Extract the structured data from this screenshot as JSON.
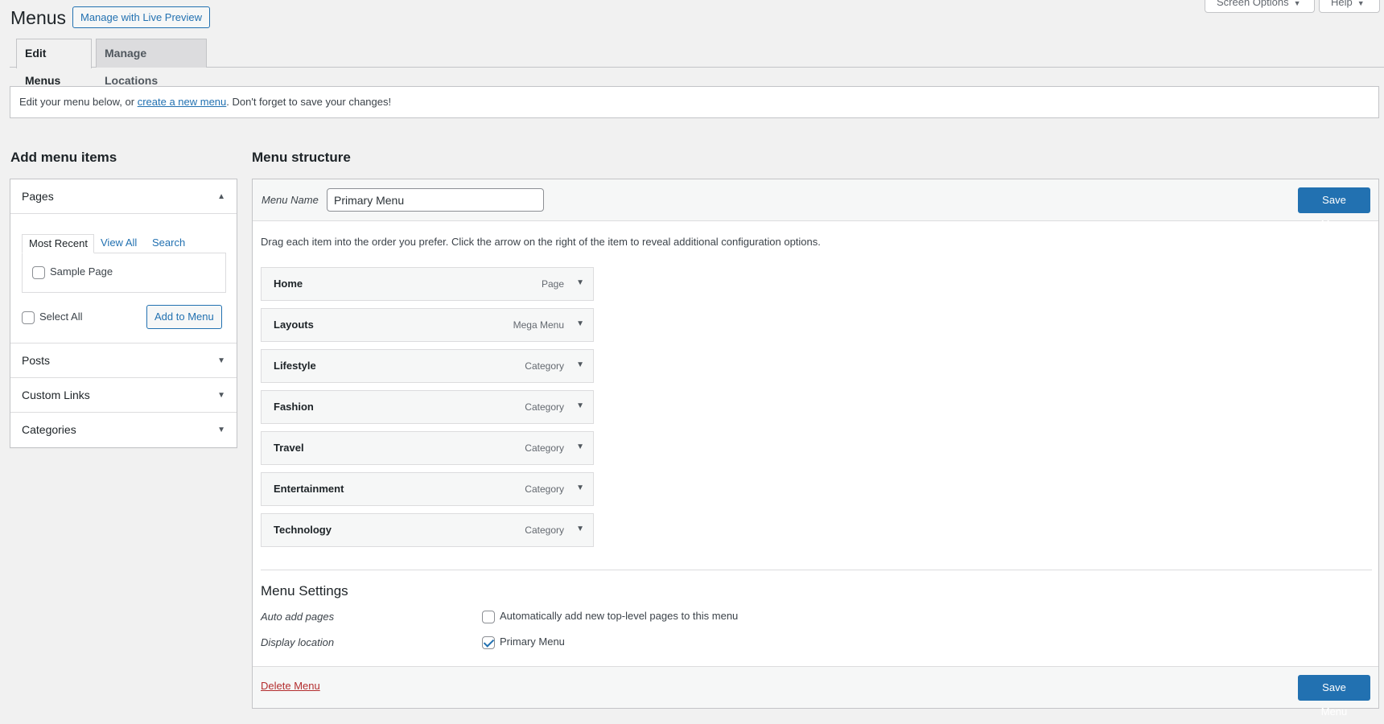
{
  "header": {
    "title": "Menus",
    "live_preview_label": "Manage with Live Preview",
    "screen_options_label": "Screen Options",
    "help_label": "Help"
  },
  "tabs": [
    {
      "label": "Edit Menus",
      "active": true
    },
    {
      "label": "Manage Locations",
      "active": false
    }
  ],
  "notice": {
    "before": "Edit your menu below, or ",
    "link": "create a new menu",
    "after": ". Don't forget to save your changes!"
  },
  "left": {
    "heading": "Add menu items",
    "pages": {
      "title": "Pages",
      "tabs": [
        "Most Recent",
        "View All",
        "Search"
      ],
      "items": [
        {
          "label": "Sample Page",
          "checked": false
        }
      ],
      "select_all_label": "Select All",
      "add_button_label": "Add to Menu"
    },
    "sections": [
      "Posts",
      "Custom Links",
      "Categories"
    ]
  },
  "right": {
    "heading": "Menu structure",
    "menu_name_label": "Menu Name",
    "menu_name_value": "Primary Menu",
    "save_label": "Save Menu",
    "instructions": "Drag each item into the order you prefer. Click the arrow on the right of the item to reveal additional configuration options.",
    "items": [
      {
        "title": "Home",
        "type": "Page"
      },
      {
        "title": "Layouts",
        "type": "Mega Menu"
      },
      {
        "title": "Lifestyle",
        "type": "Category"
      },
      {
        "title": "Fashion",
        "type": "Category"
      },
      {
        "title": "Travel",
        "type": "Category"
      },
      {
        "title": "Entertainment",
        "type": "Category"
      },
      {
        "title": "Technology",
        "type": "Category"
      }
    ],
    "settings": {
      "heading": "Menu Settings",
      "auto_add_label": "Auto add pages",
      "auto_add_option": "Automatically add new top-level pages to this menu",
      "auto_add_checked": false,
      "display_location_label": "Display location",
      "display_location_option": "Primary Menu",
      "display_location_checked": true
    },
    "delete_label": "Delete Menu"
  },
  "colors": {
    "accent": "#2271b1",
    "danger": "#b32d2e",
    "background": "#f1f1f1"
  }
}
